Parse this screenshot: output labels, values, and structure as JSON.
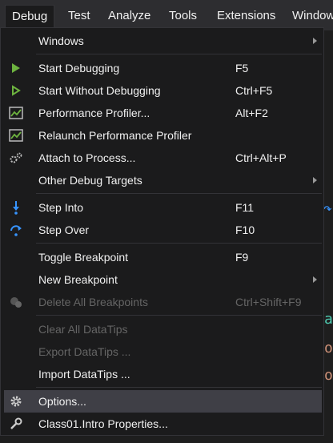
{
  "menubar": {
    "items": [
      {
        "label": "Debug"
      },
      {
        "label": "Test"
      },
      {
        "label": "Analyze"
      },
      {
        "label": "Tools"
      },
      {
        "label": "Extensions"
      },
      {
        "label": "Window"
      }
    ]
  },
  "debug_menu": {
    "windows": {
      "label": "Windows"
    },
    "start_debugging": {
      "label": "Start Debugging",
      "shortcut": "F5"
    },
    "start_without_debugging": {
      "label": "Start Without Debugging",
      "shortcut": "Ctrl+F5"
    },
    "performance_profiler": {
      "label": "Performance Profiler...",
      "shortcut": "Alt+F2"
    },
    "relaunch_profiler": {
      "label": "Relaunch Performance Profiler"
    },
    "attach_to_process": {
      "label": "Attach to Process...",
      "shortcut": "Ctrl+Alt+P"
    },
    "other_debug_targets": {
      "label": "Other Debug Targets"
    },
    "step_into": {
      "label": "Step Into",
      "shortcut": "F11"
    },
    "step_over": {
      "label": "Step Over",
      "shortcut": "F10"
    },
    "toggle_breakpoint": {
      "label": "Toggle Breakpoint",
      "shortcut": "F9"
    },
    "new_breakpoint": {
      "label": "New Breakpoint"
    },
    "delete_all_breakpoints": {
      "label": "Delete All Breakpoints",
      "shortcut": "Ctrl+Shift+F9"
    },
    "clear_all_datatips": {
      "label": "Clear All DataTips"
    },
    "export_datatips": {
      "label": "Export DataTips ..."
    },
    "import_datatips": {
      "label": "Import DataTips ..."
    },
    "options": {
      "label": "Options..."
    },
    "properties": {
      "label": "Class01.Intro Properties..."
    }
  },
  "colors": {
    "accent_green": "#6db33f",
    "accent_blue": "#3794ff",
    "menu_bg": "#1b1b1c",
    "highlight": "#3f3f46"
  }
}
